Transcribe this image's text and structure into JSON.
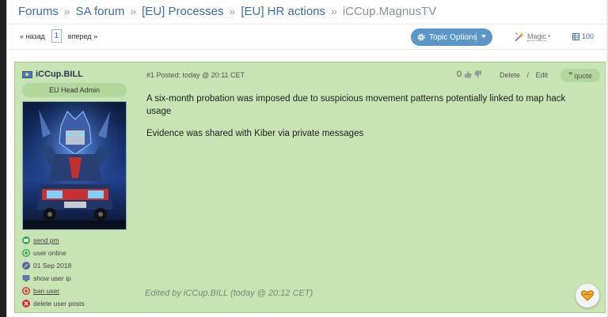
{
  "breadcrumb": {
    "items": [
      "Forums",
      "SA forum",
      "[EU] Processes",
      "[EU] HR actions"
    ],
    "separator": "»",
    "current": "iCCup.MagnusTV"
  },
  "pager": {
    "prev": "« назад",
    "page": "1",
    "next": "вперед »"
  },
  "toolbar": {
    "topic_options": "Topic Options",
    "magic": "Magic",
    "count": "100"
  },
  "post": {
    "author": "iCCup.BILL",
    "rank": "EU Head Admin",
    "meta": "#1 Posted: today @ 20:11 CET",
    "rating": "0",
    "delete": "Delete",
    "action_sep": "/",
    "edit": "Edit",
    "quote": "quote",
    "body": [
      "A six-month probation was imposed due to suspicious movement patterns potentially linked to map hack usage",
      "Evidence was shared with Kiber via private messages"
    ],
    "edited": "Edited by iCCup.BILL (today @ 20:12 CET)"
  },
  "user_links": {
    "send_pm": "send pm",
    "online": "user online",
    "joined": "01 Sep 2018",
    "show_ip": "show user ip",
    "ban": "ban user",
    "delete_posts": "delete user posts"
  },
  "colors": {
    "post_bg": "#c8e3b4",
    "link": "#3b6ea5",
    "button": "#5a97c8"
  }
}
